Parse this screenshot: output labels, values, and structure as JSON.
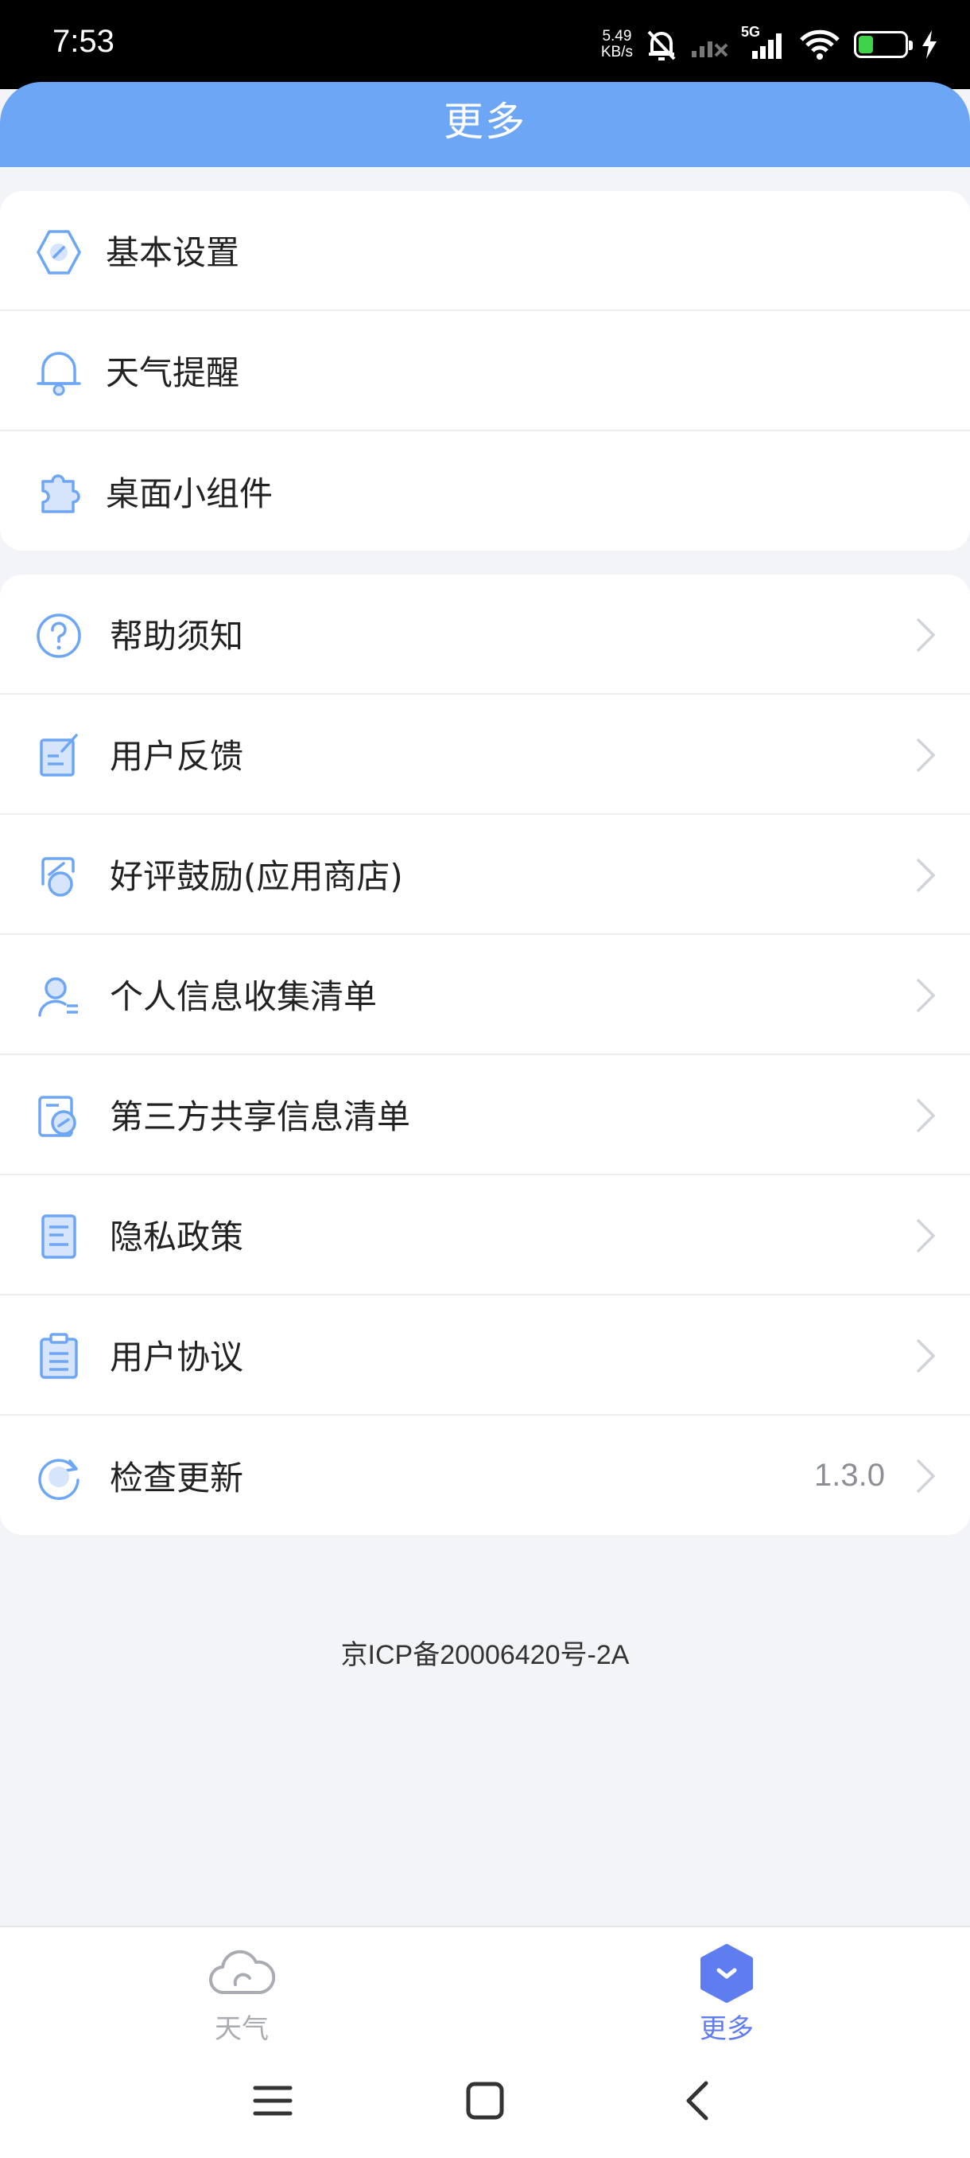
{
  "status_bar": {
    "time": "7:53",
    "net_speed_value": "5.49",
    "net_speed_unit": "KB/s",
    "network_type": "5G",
    "battery_level": "32",
    "battery_fraction": 0.32,
    "battery_color": "#3fd24b"
  },
  "header": {
    "title": "更多",
    "background_color": "#6ea6f6"
  },
  "settings_group": {
    "items": [
      {
        "label": "基本设置",
        "icon": "settings-hexagon-icon"
      },
      {
        "label": "天气提醒",
        "icon": "bell-icon"
      },
      {
        "label": "桌面小组件",
        "icon": "widget-puzzle-icon"
      }
    ]
  },
  "info_group": {
    "items": [
      {
        "label": "帮助须知",
        "icon": "help-question-icon"
      },
      {
        "label": "用户反馈",
        "icon": "feedback-edit-icon"
      },
      {
        "label": "好评鼓励(应用商店)",
        "icon": "rate-app-icon"
      },
      {
        "label": "个人信息收集清单",
        "icon": "personal-info-icon"
      },
      {
        "label": "第三方共享信息清单",
        "icon": "third-party-share-icon"
      },
      {
        "label": "隐私政策",
        "icon": "privacy-document-icon"
      },
      {
        "label": "用户协议",
        "icon": "user-agreement-icon"
      },
      {
        "label": "检查更新",
        "icon": "check-update-icon",
        "value": "1.3.0"
      }
    ]
  },
  "footer": {
    "icp": "京ICP备20006420号-2A"
  },
  "bottom_nav": {
    "tabs": [
      {
        "label": "天气",
        "icon": "cloud-icon",
        "active": false
      },
      {
        "label": "更多",
        "icon": "more-hexagon-icon",
        "active": true
      }
    ],
    "active_color": "#5f7cf0",
    "inactive_color": "#a9adb3"
  },
  "accent_color": "#6ea6f6"
}
